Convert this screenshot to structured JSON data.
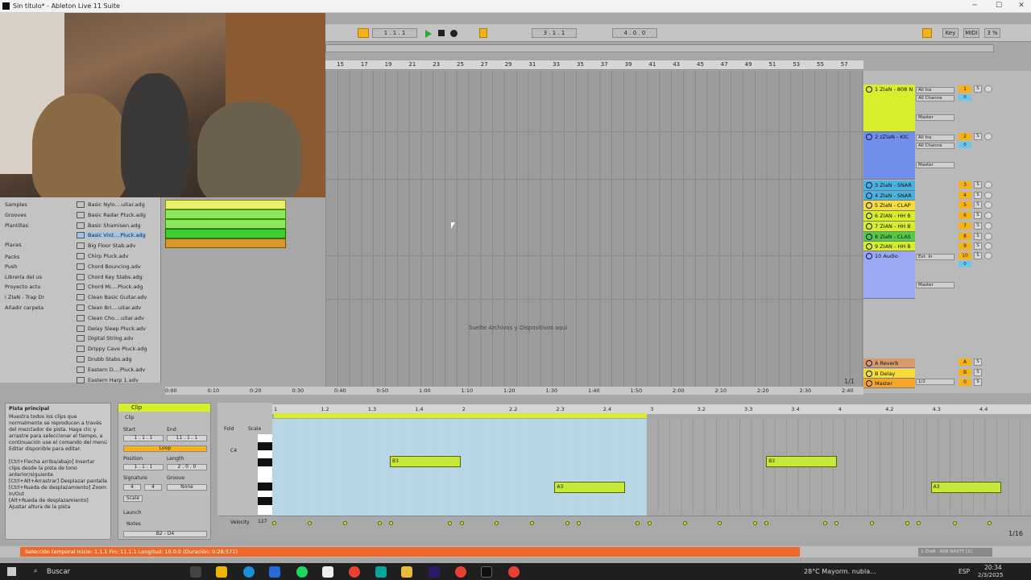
{
  "window": {
    "title": "Sin título* - Ableton Live 11 Suite"
  },
  "transport": {
    "position": "1 . 1 . 1",
    "start": "3 . 1 . 1",
    "length": "4 . 0 . 0",
    "key_label": "Key",
    "midi_label": "MIDI",
    "cpu": "3 %"
  },
  "ruler": {
    "bars": [
      "15",
      "17",
      "19",
      "21",
      "23",
      "25",
      "27",
      "29",
      "31",
      "33",
      "35",
      "37",
      "39",
      "41",
      "43",
      "45",
      "47",
      "49",
      "51",
      "53",
      "55",
      "57"
    ]
  },
  "tracks": [
    {
      "name": "1 ZIaN - 808 N",
      "num": "1",
      "color": "#d7ee2c",
      "input": "All Ins",
      "channel": "All Channe",
      "out": "Master"
    },
    {
      "name": "2 zZIaN - KIC",
      "num": "2",
      "color": "#6f8fe8",
      "input": "All Ins",
      "channel": "All Channe",
      "out": "Master"
    },
    {
      "name": "3 ZIaN - SNAR",
      "num": "3",
      "color": "#4bb2df"
    },
    {
      "name": "4 ZIaN - SNAR",
      "num": "4",
      "color": "#4bb2df"
    },
    {
      "name": "5 ZIaN - CLAP",
      "num": "5",
      "color": "#f7dc3a"
    },
    {
      "name": "6 ZIAN - HH B",
      "num": "6",
      "color": "#d7ee2c"
    },
    {
      "name": "7 ZIAN - HH B",
      "num": "7",
      "color": "#d7ee2c"
    },
    {
      "name": "8 ZIaN - CLAS",
      "num": "8",
      "color": "#55c84a"
    },
    {
      "name": "9 ZIAN - HH B",
      "num": "9",
      "color": "#d7ee2c"
    },
    {
      "name": "10 Audio",
      "num": "10",
      "color": "#9aa8f5",
      "input": "Ext. In",
      "out": "Master"
    }
  ],
  "returns": [
    {
      "name": "A Reverb",
      "num": "A"
    },
    {
      "name": "B Delay",
      "num": "B"
    },
    {
      "name": "Master",
      "num": "0",
      "out": "1/2"
    }
  ],
  "arrangement": {
    "drop_hint": "Suelte Archivos y Dispositivos aquí",
    "zoom": "1/1"
  },
  "browser": {
    "categories": [
      "Samples",
      "Grooves",
      "Plantillas",
      "Places",
      "Packs",
      "Push",
      "Librería del us",
      "Proyecto actu",
      "i ZIaN - Trap Dr",
      "Añadir carpeta"
    ],
    "files": [
      "Basic Nylo....uitar.adg",
      "Basic Radar Pluck.adg",
      "Basic Shamisen.adg",
      "Basic Vint....Pluck.adg",
      "Big Floor Stab.adv",
      "Chirp Pluck.adv",
      "Chord Bouncing.adv",
      "Chord Key Stabs.adg",
      "Chord Mi....Pluck.adg",
      "Clean Basic Guitar.adv",
      "Clean Bri....uitar.adv",
      "Clean Cho....uitar.adv",
      "Delay Sleep Pluck.adv",
      "Digital String.adv",
      "Drippy Cave Pluck.adg",
      "Drubb Stabs.adg",
      "Eastern D....Pluck.adv",
      "Eastern Harp 1.adv"
    ]
  },
  "timebar": [
    "0:00",
    "0:10",
    "0:20",
    "0:30",
    "0:40",
    "0:50",
    "1:00",
    "1:10",
    "1:20",
    "1:30",
    "1:40",
    "1:50",
    "2:00",
    "2:10",
    "2:20",
    "2:30",
    "2:40"
  ],
  "info": {
    "title": "Pista principal",
    "body": "Muestra todos los clips que normalmente se reproducen a través del mezclador de pista. Haga clic y arrastre para seleccionar el tiempo, a continuación use el comando del menú Editar disponible para editar.\n\n[Ctrl+Flecha arriba/abajo] Insertar clips desde la pista de tono anterior/siguiente\n[Ctrl+Alt+Arrastrar] Desplazar pantalla\n[Ctrl+Rueda de desplazamiento] Zoom In/Out\n[Alt+Rueda de desplazamiento] Ajustar altura de la pista"
  },
  "clip": {
    "header": "Clip",
    "clip_label": "Clip",
    "start": "Start",
    "end": "End",
    "set": "Set",
    "start_val": "1 . 1 . 1",
    "end_val": "11 . 1 . 1",
    "loop": "Loop",
    "position": "Position",
    "length": "Length",
    "pos_val": "1 . 1 . 1",
    "len_val": "2 . 0 . 0",
    "signature": "Signature",
    "groove": "Groove",
    "sig_num": "4",
    "sig_den": "4",
    "groove_val": "None",
    "scale": "Scale",
    "launch": "Launch",
    "notes": "Notes",
    "range": "B2 - D4"
  },
  "noteeditor": {
    "fold": "Fold",
    "scale": "Scale",
    "c4": "C4",
    "velocity": "Velocity",
    "vel_max": "127",
    "page": "1/16",
    "ruler": [
      "1",
      "1.2",
      "1.3",
      "1.4",
      "2",
      "2.2",
      "2.3",
      "2.4",
      "3",
      "3.2",
      "3.3",
      "3.4",
      "4",
      "4.2",
      "4.3",
      "4.4"
    ],
    "notes": [
      {
        "label": "B3",
        "start": 1.625,
        "dur": 0.375,
        "row": 0
      },
      {
        "label": "A3",
        "start": 2.5,
        "dur": 0.375,
        "row": 1
      },
      {
        "label": "B3",
        "start": 3.625,
        "dur": 0.375,
        "row": 0
      },
      {
        "label": "A3",
        "start": 4.5,
        "dur": 0.375,
        "row": 1
      }
    ]
  },
  "status": {
    "text": "Selección temporal   Inicio: 1.1.1   Fin: 11.1.1   Longitud: 10.0.0  (Duración: 0:28:571)",
    "track": "1-ZIaN - 808 NASTY [1]"
  },
  "taskbar": {
    "search": "Buscar",
    "weather": "28°C  Mayorm. nubla...",
    "lang": "ESP",
    "time": "20:34",
    "date": "2/3/2025"
  }
}
